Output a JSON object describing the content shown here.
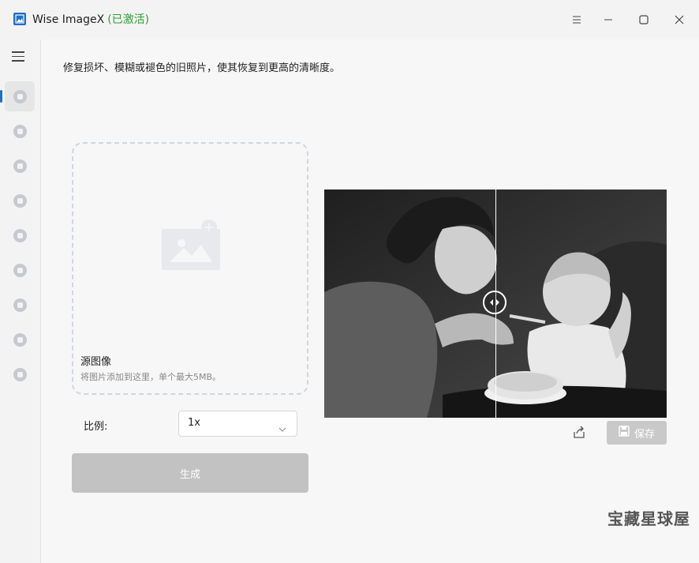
{
  "window": {
    "title": "Wise ImageX",
    "status": "(已激活)",
    "status_color": "#2e9e38",
    "controls": [
      "menu-icon",
      "minimize-icon",
      "maximize-icon",
      "close-icon"
    ]
  },
  "sidebar": {
    "active_index": 0,
    "items": [
      {
        "icon": "photo-restore-icon"
      },
      {
        "icon": "color-fill-icon"
      },
      {
        "icon": "portrait-icon"
      },
      {
        "icon": "face-enhance-icon"
      },
      {
        "icon": "bg-remove-icon"
      },
      {
        "icon": "image-stack-icon"
      },
      {
        "icon": "contrast-icon"
      },
      {
        "icon": "compress-icon"
      },
      {
        "icon": "edit-icon"
      }
    ]
  },
  "main": {
    "description": "修复损坏、模糊或褪色的旧照片，使其恢复到更高的清晰度。",
    "dropzone": {
      "title": "源图像",
      "hint": "将图片添加到这里，单个最大5MB。"
    },
    "ratio": {
      "label": "比例:",
      "value": "1x"
    },
    "generate_label": "生成",
    "preview": {
      "divider_position": 0.5
    },
    "save_label": "保存"
  },
  "watermark": "宝藏星球屋",
  "colors": {
    "accent": "#1f6fc5",
    "button_disabled": "#c2c2c2"
  }
}
